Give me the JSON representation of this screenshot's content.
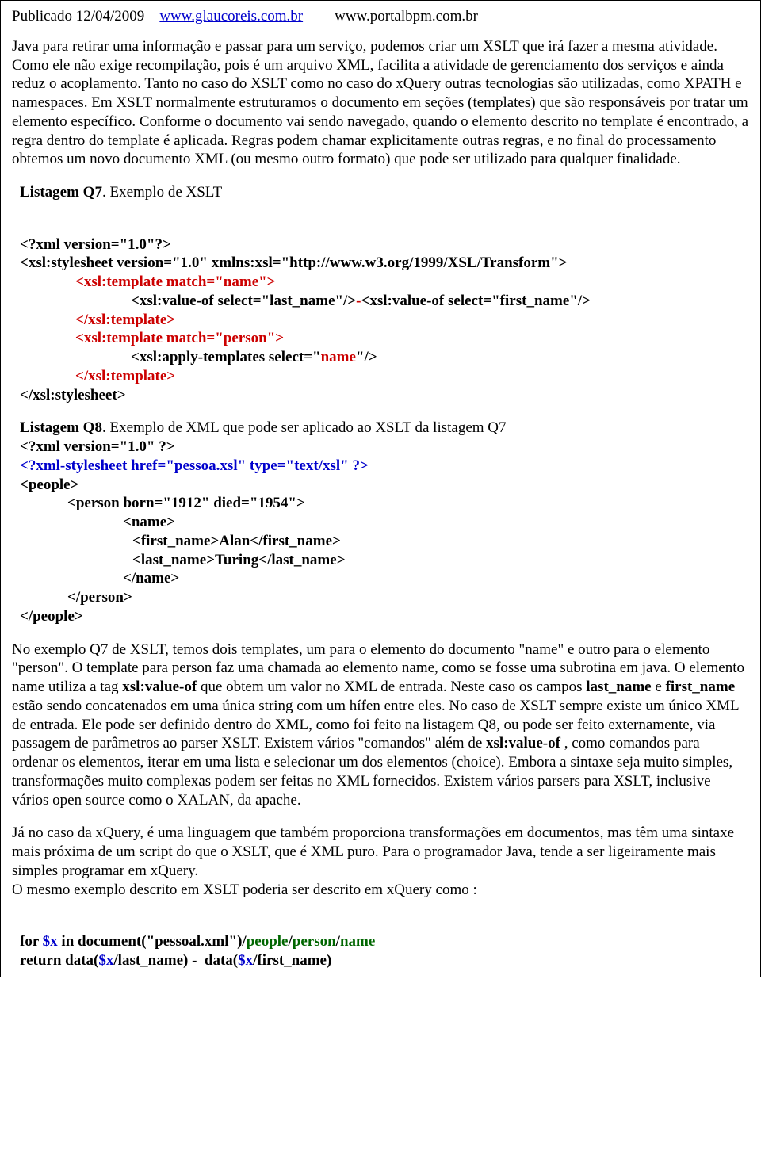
{
  "header": {
    "published": "Publicado 12/04/2009 – ",
    "link1": "www.glaucoreis.com.br",
    "link2": "www.portalbpm.com.br"
  },
  "para1": "Java para retirar uma informação e passar para um serviço, podemos criar um XSLT que irá fazer a mesma atividade. Como ele não exige recompilação, pois é um arquivo XML, facilita a atividade de gerenciamento dos serviços e ainda reduz o acoplamento. Tanto no caso do XSLT como no caso do xQuery outras tecnologias são utilizadas, como XPATH e namespaces. Em XSLT normalmente estruturamos o documento em seções (templates) que são responsáveis por tratar um elemento específico. Conforme o documento vai sendo navegado, quando o elemento descrito no template é encontrado, a regra dentro do template é aplicada. Regras podem chamar explicitamente outras regras, e no final do processamento obtemos um novo documento XML (ou mesmo outro formato) que pode ser utilizado para qualquer finalidade.",
  "listingQ7": {
    "label_bold": "Listagem Q7",
    "label_rest": ". Exemplo de XSLT",
    "l1": "<?xml version=\"1.0\"?>",
    "l2": "<xsl:stylesheet version=\"1.0\" xmlns:xsl=\"http://www.w3.org/1999/XSL/Transform\">",
    "l3": "<xsl:template match=\"name\">",
    "l4a": "<xsl:value-of select=\"last_name\"/>",
    "l4b": "-",
    "l4c": "<xsl:value-of select=\"first_name\"/>",
    "l5": "</xsl:template>",
    "l6": "<xsl:template match=\"person\">",
    "l7a": "<xsl:apply-templates select=\"",
    "l7b": "name",
    "l7c": "\"/>",
    "l8": "</xsl:template>",
    "l9": "</xsl:stylesheet>"
  },
  "listingQ8": {
    "label_bold": "Listagem Q8",
    "label_rest": ". Exemplo de XML que pode ser aplicado ao XSLT da listagem Q7",
    "l1": "<?xml version=\"1.0\" ?>",
    "l2": "<?xml-stylesheet href=\"pessoa.xsl\" type=\"text/xsl\" ?>",
    "l3": "<people>",
    "l4": "<person born=\"1912\" died=\"1954\">",
    "l5": "<name>",
    "l6": "<first_name>Alan</first_name>",
    "l7": "<last_name>Turing</last_name>",
    "l8": "</name>",
    "l9": "</person>",
    "l10": "</people>"
  },
  "para2": {
    "t1": "  No exemplo Q7 de XSLT, temos dois templates, um para o elemento do documento \"name\" e outro para o elemento \"person\". O template para person faz uma chamada ao elemento name, como se fosse uma subrotina em java. O elemento name utiliza a tag ",
    "b1": "xsl:value-of",
    "t2": " que obtem um valor no XML de entrada. Neste caso os campos ",
    "b2": "last_name",
    "t3": " e ",
    "b3": "first_name",
    "t4": " estão sendo concatenados em uma única string com um hífen entre eles. No caso de XSLT sempre existe um único XML de entrada. Ele pode ser definido dentro do XML, como foi feito na listagem Q8, ou pode ser feito externamente, via passagem de parâmetros ao parser XSLT. Existem vários \"comandos\" além de ",
    "b4": "xsl:value-of",
    "t5": " , como comandos para ordenar os elementos, iterar em uma lista e selecionar um dos elementos (choice). Embora a sintaxe seja muito simples, transformações muito complexas podem ser feitas no XML fornecidos. Existem vários parsers para XSLT, inclusive vários open source como o XALAN, da apache."
  },
  "para3": {
    "t1": "  Já no caso da xQuery, é uma linguagem que também proporciona transformações em documentos, mas têm uma sintaxe mais próxima de um script do que o XSLT, que é XML puro. Para o programador Java, tende a ser ligeiramente mais simples programar em xQuery.",
    "t2": "  O mesmo exemplo descrito em XSLT poderia ser descrito em xQuery como :"
  },
  "xquery": {
    "l1a": "for ",
    "l1b": "$x",
    "l1c": " in document(\"pessoal.xml\")/",
    "l1d": "people",
    "l1e": "/",
    "l1f": "person",
    "l1g": "/",
    "l1h": "name",
    "l2a": "return data(",
    "l2b": "$x",
    "l2c": "/last_name) -  data(",
    "l2d": "$x",
    "l2e": "/first_name)"
  }
}
